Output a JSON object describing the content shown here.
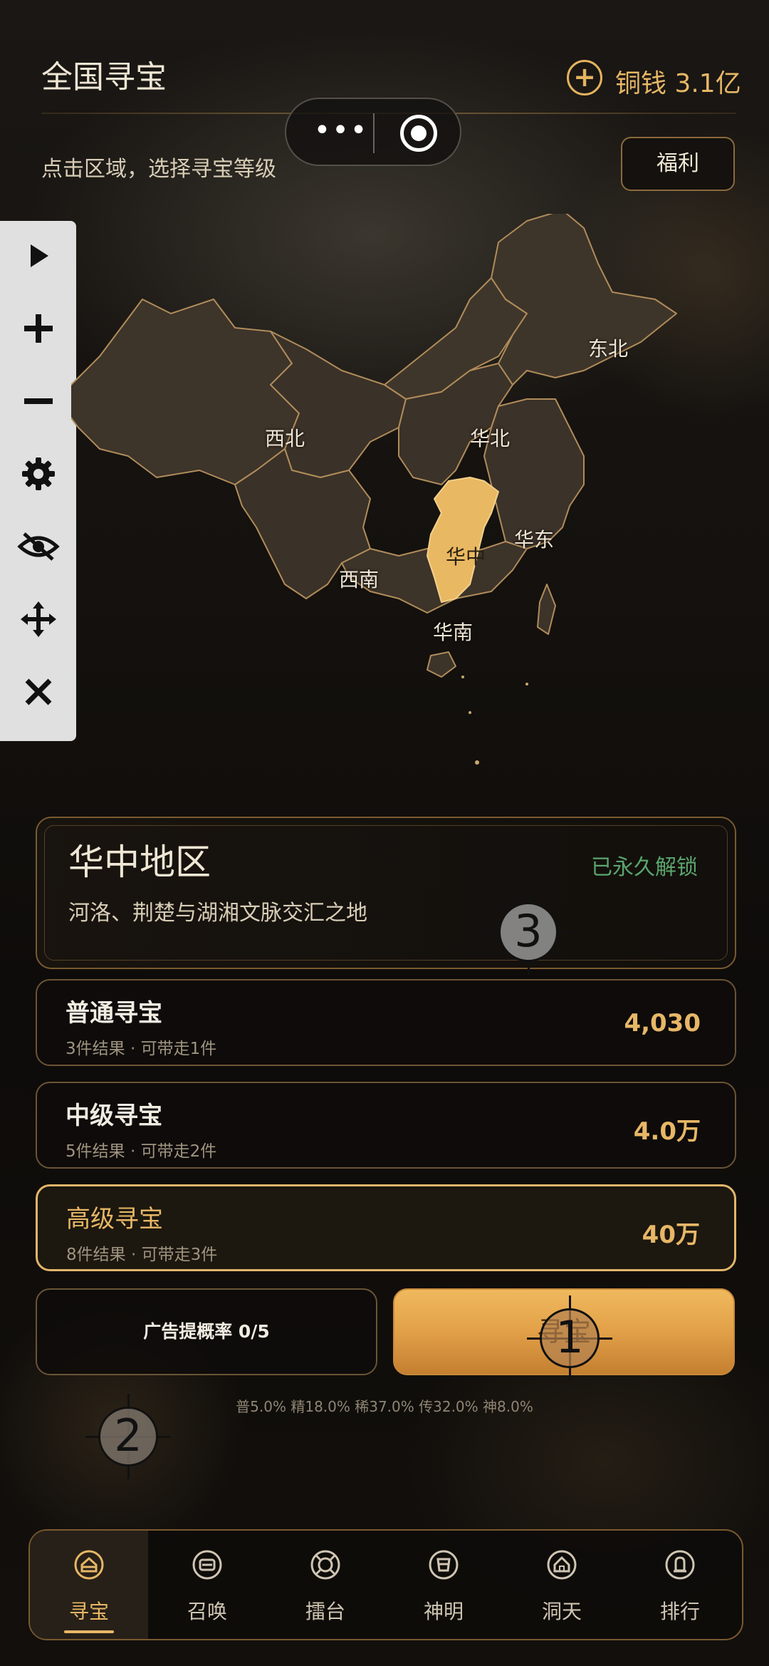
{
  "header": {
    "title": "全国寻宝",
    "subtitle": "点击区域，选择寻宝等级",
    "coins_label": "铜钱 3.1亿",
    "welfare_label": "福利",
    "capsule_menu": "•••"
  },
  "toolbar": {
    "items": [
      "play-icon",
      "plus-icon",
      "minus-icon",
      "gear-icon",
      "eye-off-icon",
      "move-icon",
      "close-icon"
    ]
  },
  "map": {
    "regions": {
      "northeast": "东北",
      "northwest": "西北",
      "north": "华北",
      "east": "华东",
      "central": "华中",
      "southwest": "西南",
      "south": "华南"
    },
    "selected": "central",
    "highlight_color": "#e9b862"
  },
  "region_card": {
    "name": "华中地区",
    "description": "河洛、荆楚与湖湘文脉交汇之地",
    "status": "已永久解锁"
  },
  "tiers": [
    {
      "name": "普通寻宝",
      "detail": "3件结果 · 可带走1件",
      "price": "4,030"
    },
    {
      "name": "中级寻宝",
      "detail": "5件结果 · 可带走2件",
      "price": "4.0万"
    },
    {
      "name": "高级寻宝",
      "detail": "8件结果 · 可带走3件",
      "price": "40万"
    }
  ],
  "actions": {
    "ad_label": "广告提概率 0/5",
    "main_label": "寻宝"
  },
  "odds_text": "普5.0%  精18.0%  稀37.0%  传32.0%  神8.0%",
  "markers": [
    "1",
    "2",
    "3"
  ],
  "nav": {
    "items": [
      {
        "label": "寻宝",
        "icon": "treasure-icon"
      },
      {
        "label": "召唤",
        "icon": "summon-icon"
      },
      {
        "label": "擂台",
        "icon": "arena-icon"
      },
      {
        "label": "神明",
        "icon": "deity-icon"
      },
      {
        "label": "洞天",
        "icon": "cave-icon"
      },
      {
        "label": "排行",
        "icon": "ranking-icon"
      }
    ],
    "active_index": 0
  },
  "colors": {
    "accent": "#e7b766",
    "unlocked": "#5aa56c",
    "border": "#7a5a30"
  }
}
